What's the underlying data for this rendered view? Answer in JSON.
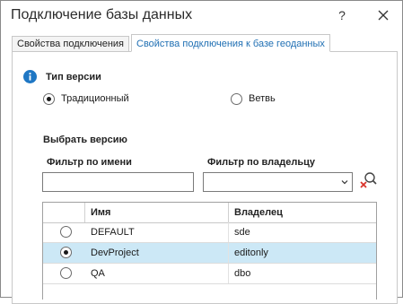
{
  "dialog": {
    "title": "Подключение базы данных",
    "help_label": "?"
  },
  "tabs": [
    {
      "label": "Свойства подключения",
      "active": false
    },
    {
      "label": "Свойства подключения к базе геоданных",
      "active": true
    }
  ],
  "version_type": {
    "title": "Тип версии",
    "options": [
      {
        "label": "Традиционный",
        "checked": true
      },
      {
        "label": "Ветвь",
        "checked": false
      }
    ]
  },
  "choose_version": {
    "title": "Выбрать версию",
    "name_filter": {
      "label": "Фильтр по имени",
      "value": ""
    },
    "owner_filter": {
      "label": "Фильтр по владельцу",
      "value": ""
    }
  },
  "versions_table": {
    "columns": [
      "",
      "Имя",
      "Владелец"
    ],
    "rows": [
      {
        "name": "DEFAULT",
        "owner": "sde",
        "selected": false
      },
      {
        "name": "DevProject",
        "owner": "editonly",
        "selected": true
      },
      {
        "name": "QA",
        "owner": "dbo",
        "selected": false
      }
    ]
  },
  "colors": {
    "accent": "#1f6fb3",
    "info_icon": "#1f77c4",
    "selected_row": "#cce8f6",
    "clear_icon_x": "#d9342b"
  },
  "icons": {
    "info": "info-icon",
    "close": "close-icon",
    "dropdown": "chevron-down-icon",
    "clear_filter": "clear-filter-icon"
  }
}
